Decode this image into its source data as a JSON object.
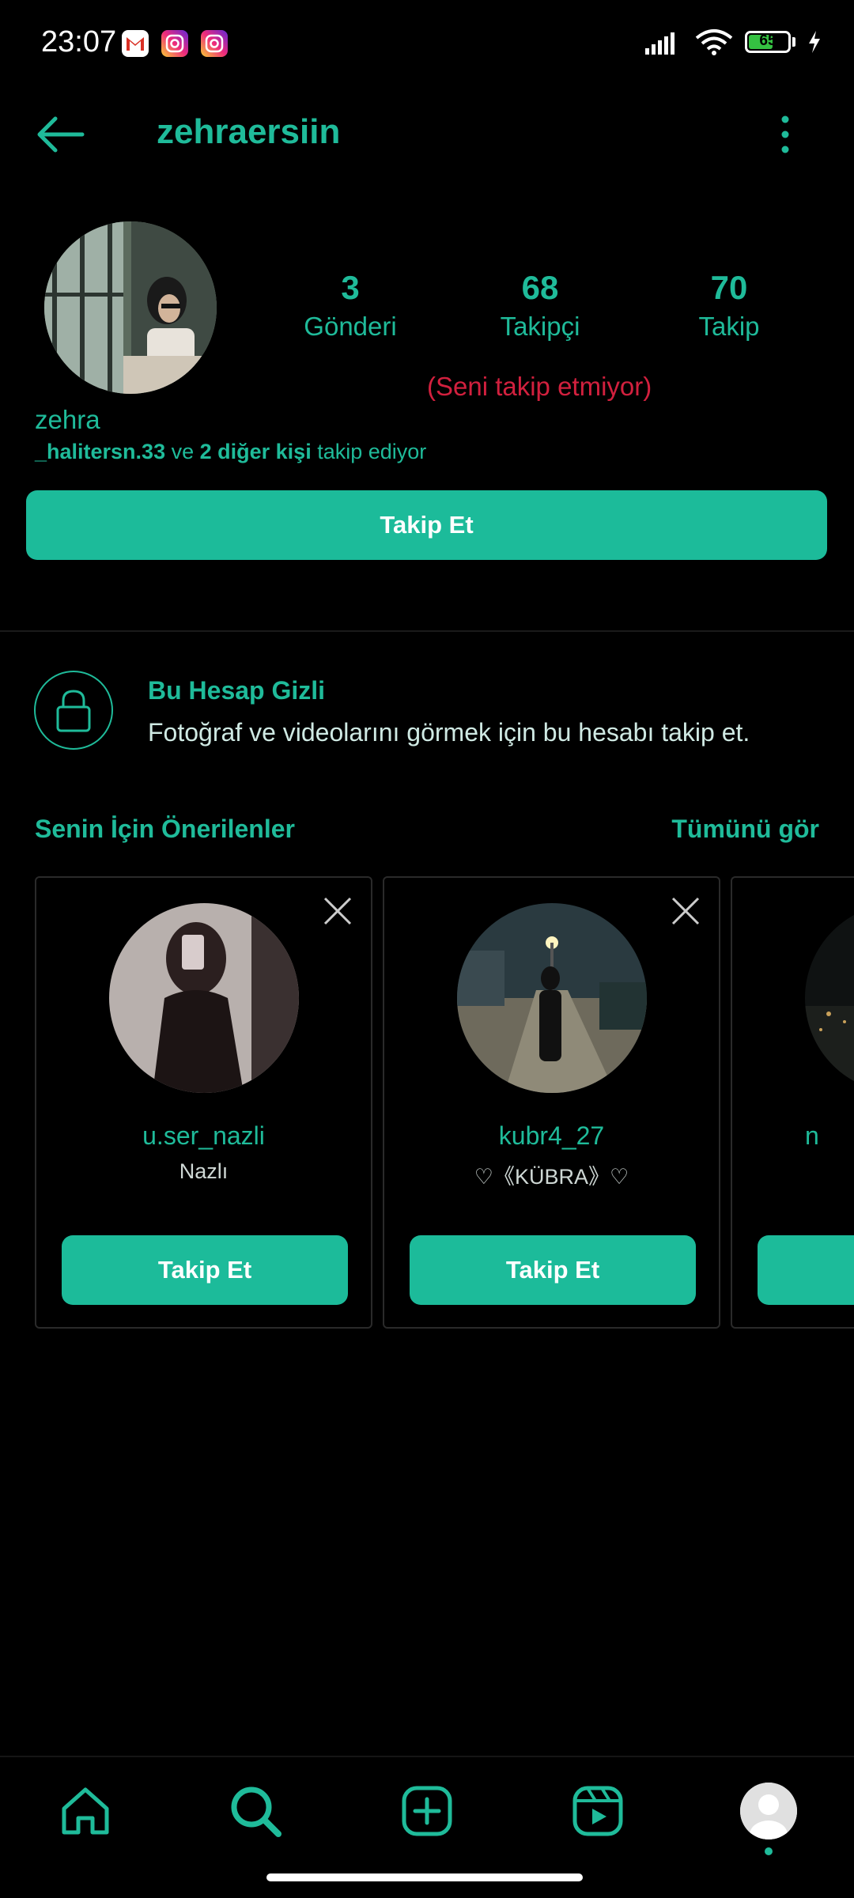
{
  "status_bar": {
    "time": "23:07",
    "notifications": [
      "gmail-icon",
      "instagram-icon",
      "instagram-icon"
    ],
    "battery": "65",
    "battery_fraction": 0.65
  },
  "header": {
    "title": "zehraersiin",
    "back_icon": "arrow-left-icon",
    "more_icon": "more-vertical-icon"
  },
  "profile": {
    "stats": [
      {
        "value": "3",
        "label": "Gönderi"
      },
      {
        "value": "68",
        "label": "Takipçi"
      },
      {
        "value": "70",
        "label": "Takip"
      }
    ],
    "not_following_note": "(Seni takip etmiyor)",
    "display_name": "zehra",
    "followed_by_user": "_halitersn.33",
    "followed_by_and": " ve ",
    "followed_by_others": "2 diğer kişi",
    "followed_by_suffix": " takip ediyor",
    "follow_button": "Takip Et"
  },
  "private": {
    "title": "Bu Hesap Gizli",
    "description": "Fotoğraf ve videolarını görmek için bu hesabı takip et.",
    "icon": "lock-icon"
  },
  "suggestions": {
    "title": "Senin İçin Önerilenler",
    "see_all": "Tümünü gör",
    "cards": [
      {
        "username": "u.ser_nazli",
        "name": "Nazlı",
        "button": "Takip Et"
      },
      {
        "username": "kubr4_27",
        "name": "♡《KÜBRA》♡",
        "button": "Takip Et"
      },
      {
        "username": "n",
        "name": "",
        "button": ""
      }
    ]
  },
  "bottom_nav": {
    "items": [
      "home-icon",
      "search-icon",
      "add-post-icon",
      "reels-icon",
      "profile-avatar"
    ]
  },
  "colors": {
    "accent": "#1fbb9a",
    "warning": "#d2203e",
    "background": "#000000"
  }
}
